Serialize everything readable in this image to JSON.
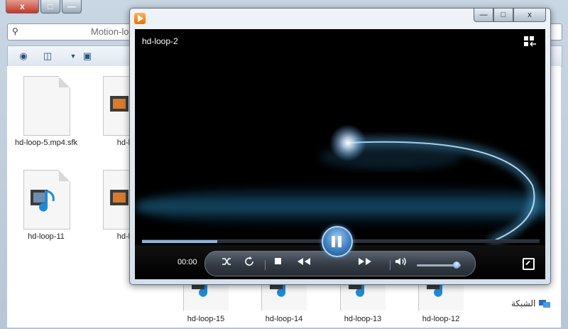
{
  "explorer": {
    "address_text": "Motion-loop",
    "files": [
      {
        "name": "hd-loop-5.mp4.sfk",
        "type": "document"
      },
      {
        "name": "hd-lo",
        "type": "video"
      },
      {
        "name": "hd-loop-11",
        "type": "audio"
      },
      {
        "name": "hd-lo",
        "type": "video"
      },
      {
        "name": "hd-loop-15",
        "type": "audio"
      },
      {
        "name": "hd-loop-14",
        "type": "audio"
      },
      {
        "name": "hd-loop-13",
        "type": "audio"
      },
      {
        "name": "hd-loop-12",
        "type": "audio"
      }
    ],
    "network_label": "الشبكة",
    "caption_buttons": {
      "close": "x",
      "maximize": "□",
      "minimize": "—"
    }
  },
  "player": {
    "title": "hd-loop-2",
    "time": "00:00",
    "seek_progress": 0.19,
    "volume_level": 0.9,
    "window_buttons": {
      "minimize": "—",
      "maximize": "□",
      "close": "x"
    },
    "icons": {
      "shuffle": "shuffle-icon",
      "repeat": "repeat-icon",
      "stop": "stop-icon",
      "previous": "previous-icon",
      "pause": "pause-icon",
      "next": "next-icon",
      "volume": "volume-icon",
      "switch_view": "switch-to-library-icon",
      "fullscreen": "fullscreen-icon"
    },
    "accent_color": "#3f7fc1"
  }
}
